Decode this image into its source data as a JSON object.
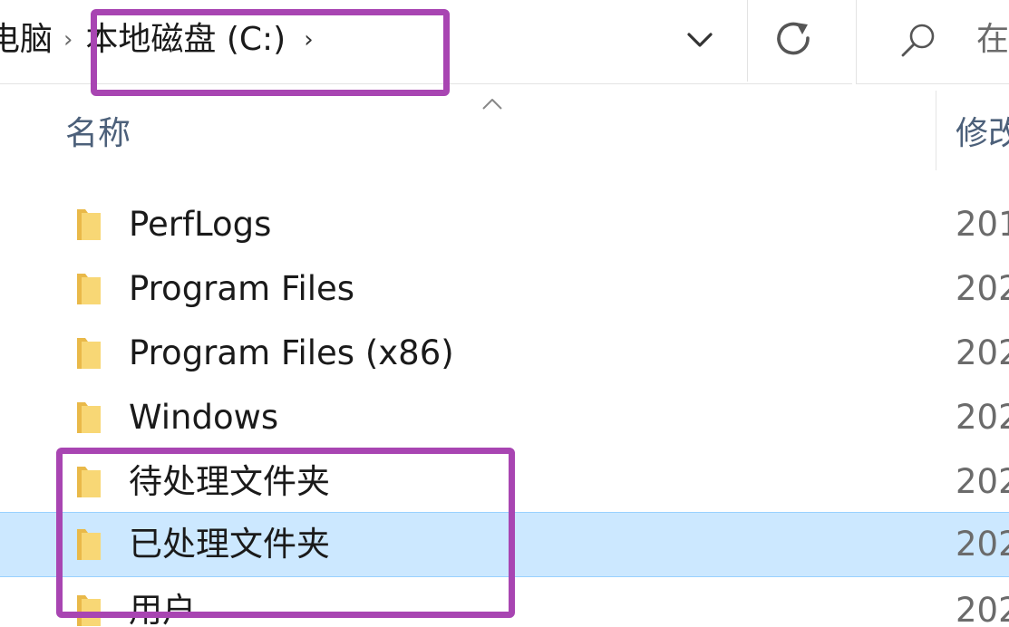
{
  "address_bar": {
    "breadcrumb": [
      "电脑",
      "本地磁盘 (C:)"
    ],
    "dropdown_icon": "chevron-down-icon",
    "refresh_icon": "refresh-icon"
  },
  "search": {
    "icon": "search-icon",
    "placeholder": "在"
  },
  "columns": {
    "name": "名称",
    "modified": "修改"
  },
  "files": [
    {
      "name": "PerfLogs",
      "date": "201",
      "selected": false
    },
    {
      "name": "Program Files",
      "date": "202",
      "selected": false
    },
    {
      "name": "Program Files (x86)",
      "date": "202",
      "selected": false
    },
    {
      "name": "Windows",
      "date": "202",
      "selected": false
    },
    {
      "name": "待处理文件夹",
      "date": "202",
      "selected": false
    },
    {
      "name": "已处理文件夹",
      "date": "202",
      "selected": true
    },
    {
      "name": "用户",
      "date": "202",
      "selected": false
    }
  ],
  "colors": {
    "highlight": "#a845b2",
    "selection": "#cce8ff",
    "folder": "#f8d775"
  }
}
